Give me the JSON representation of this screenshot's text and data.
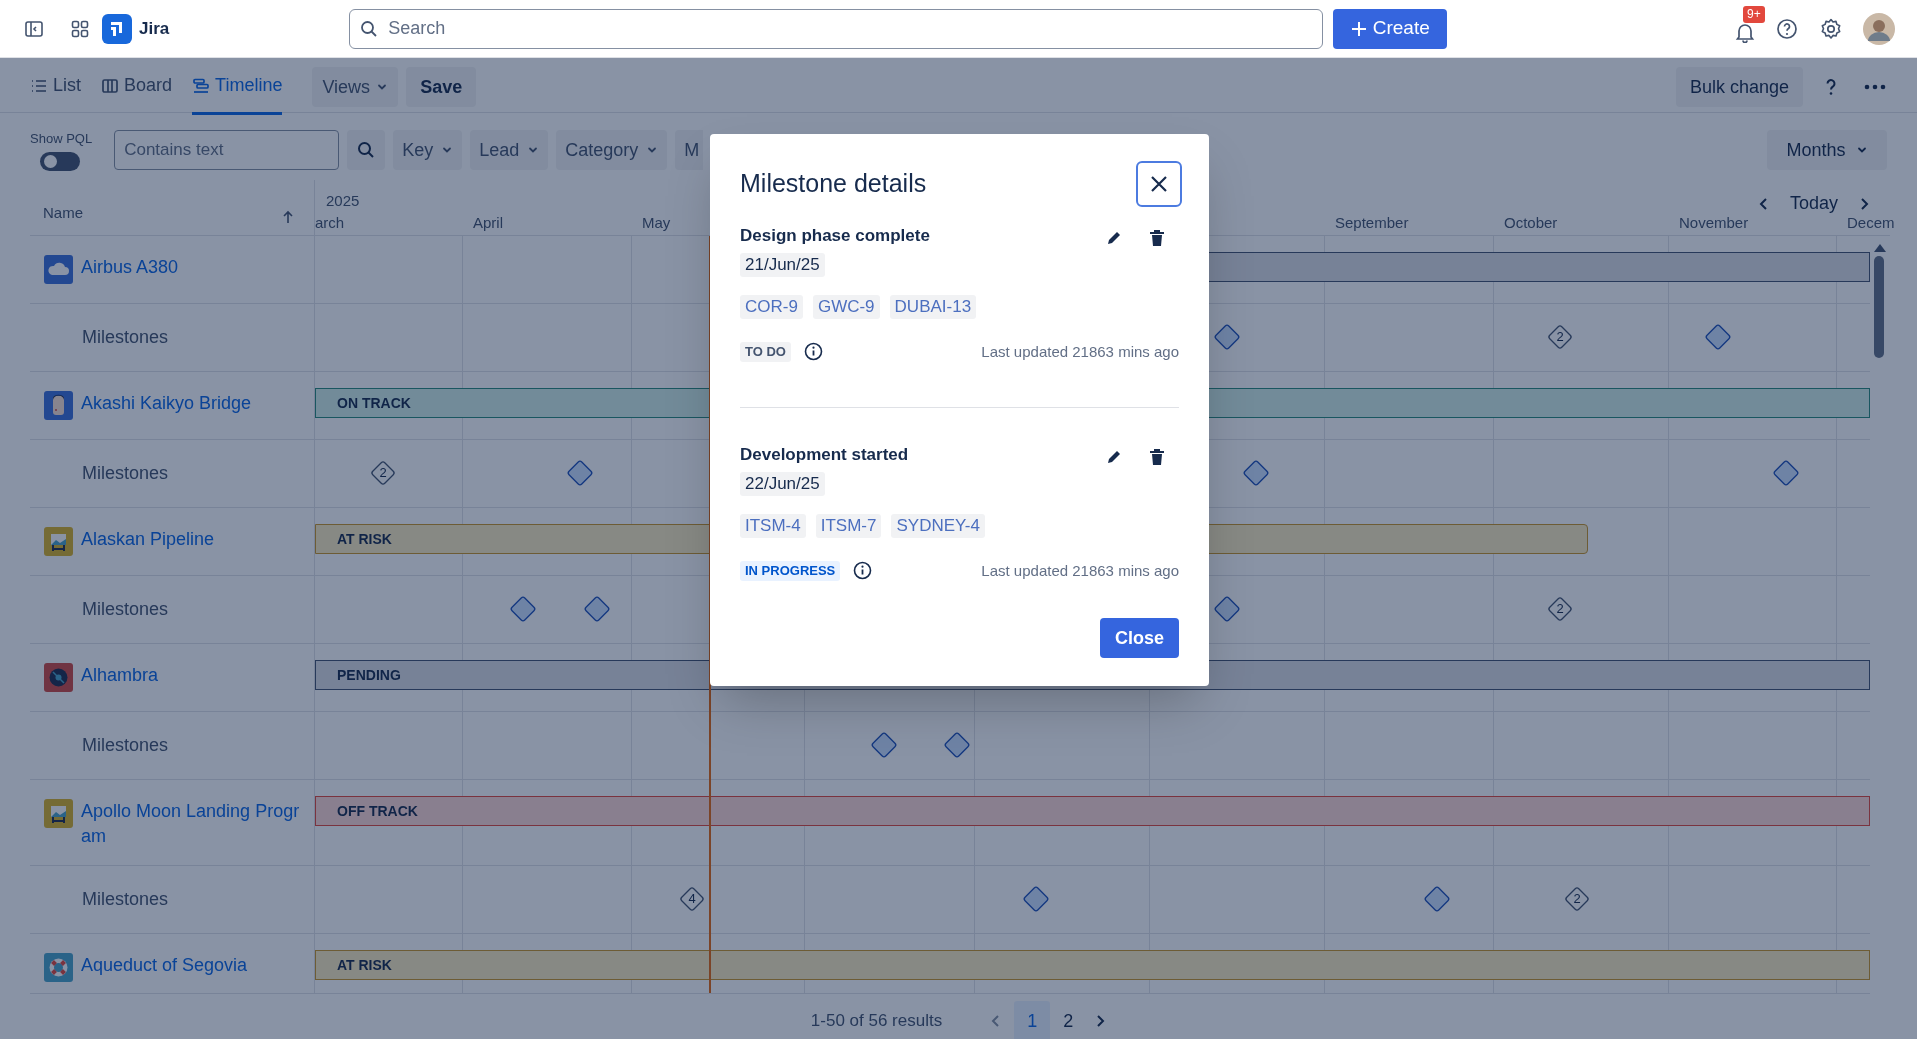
{
  "top_bar": {
    "product": "Jira",
    "search": {
      "placeholder": "Search"
    },
    "create_button": "Create",
    "notification_badge": "9+"
  },
  "toolbar": {
    "tabs": [
      {
        "label": "List",
        "kind": "list",
        "selected": false
      },
      {
        "label": "Board",
        "kind": "board",
        "selected": false
      },
      {
        "label": "Timeline",
        "kind": "timeline",
        "selected": true
      }
    ],
    "views": "Views",
    "save": "Save",
    "bulk_change": "Bulk change"
  },
  "filters": {
    "show_pql": {
      "label": "Show PQL",
      "on": false
    },
    "text_filter": {
      "placeholder": "Contains text"
    },
    "dropdowns": [
      "Key",
      "Lead",
      "Category",
      "M"
    ],
    "zoom": "Months"
  },
  "timeline": {
    "name_header": "Name",
    "year": "2025",
    "today": "Today",
    "months": [
      "arch",
      "April",
      "May",
      "September",
      "October",
      "November",
      "Decem"
    ],
    "groups": [
      {
        "name": "Airbus A380",
        "bar": {
          "kind": "pending"
        },
        "milestone_row": {
          "label": "Milestones",
          "milestones": [
            {
              "kind": "single"
            },
            {
              "kind": "cluster",
              "count": "2"
            },
            {
              "kind": "single"
            }
          ]
        }
      },
      {
        "name": "Akashi Kaikyo Bridge",
        "bar": {
          "kind": "on_track",
          "label": "ON TRACK"
        },
        "milestone_row": {
          "label": "Milestones",
          "milestones": [
            {
              "kind": "cluster",
              "count": "2"
            },
            {
              "kind": "single"
            },
            {
              "kind": "single"
            },
            {
              "kind": "single"
            }
          ]
        }
      },
      {
        "name": "Alaskan Pipeline",
        "bar": {
          "kind": "at_risk",
          "label": "AT RISK"
        },
        "milestone_row": {
          "label": "Milestones",
          "milestones": [
            {
              "kind": "single"
            },
            {
              "kind": "single"
            },
            {
              "kind": "single"
            },
            {
              "kind": "cluster",
              "count": "2"
            }
          ]
        }
      },
      {
        "name": "Alhambra",
        "bar": {
          "kind": "pending",
          "label": "PENDING"
        },
        "milestone_row": {
          "label": "Milestones",
          "milestones": [
            {
              "kind": "single"
            },
            {
              "kind": "single"
            }
          ]
        }
      },
      {
        "name": "Apollo Moon Landing Progr am",
        "bar": {
          "kind": "off_track",
          "label": "OFF TRACK"
        },
        "milestone_row": {
          "label": "Milestones",
          "milestones": [
            {
              "kind": "cluster",
              "count": "4"
            },
            {
              "kind": "single"
            },
            {
              "kind": "single"
            },
            {
              "kind": "cluster",
              "count": "2"
            }
          ]
        }
      },
      {
        "name": "Aqueduct of Segovia",
        "bar": {
          "kind": "at_risk",
          "label": "AT RISK"
        }
      }
    ]
  },
  "pagination": {
    "summary": "1-50 of 56 results",
    "pages": [
      {
        "label": "1",
        "selected": true
      },
      {
        "label": "2",
        "selected": false
      }
    ]
  },
  "modal": {
    "title": "Milestone details",
    "milestones": [
      {
        "title": "Design phase complete",
        "date": "21/Jun/25",
        "issues": [
          "COR-9",
          "GWC-9",
          "DUBAI-13"
        ],
        "status": {
          "kind": "todo",
          "label": "TO DO"
        },
        "updated": "Last updated 21863 mins ago"
      },
      {
        "title": "Development started",
        "date": "22/Jun/25",
        "issues": [
          "ITSM-4",
          "ITSM-7",
          "SYDNEY-4"
        ],
        "status": {
          "kind": "in_progress",
          "label": "IN PROGRESS"
        },
        "updated": "Last updated 21863 mins ago"
      }
    ],
    "close_button": "Close"
  }
}
